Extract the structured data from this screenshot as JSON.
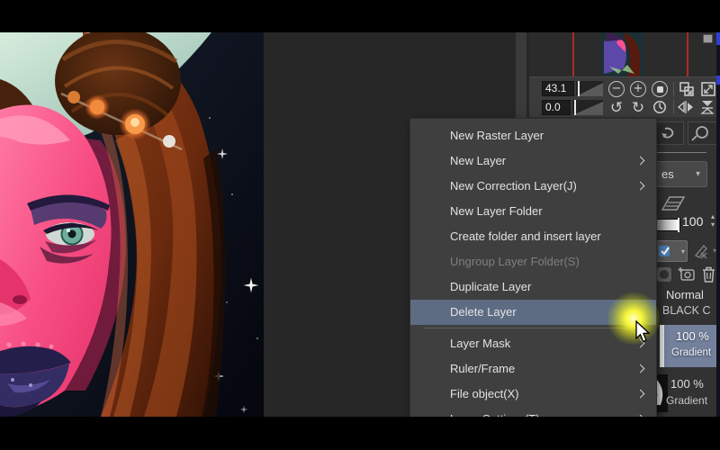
{
  "context_menu": {
    "items": [
      {
        "label": "New Raster Layer"
      },
      {
        "label": "New Layer",
        "submenu": true
      },
      {
        "label": "New Correction Layer(J)",
        "submenu": true
      },
      {
        "label": "New Layer Folder"
      },
      {
        "label": "Create folder and insert layer"
      },
      {
        "label": "Ungroup Layer Folder(S)",
        "disabled": true
      },
      {
        "label": "Duplicate Layer"
      },
      {
        "label": "Delete Layer",
        "selected": true
      },
      {
        "label": "Layer Mask",
        "submenu": true
      },
      {
        "label": "Ruler/Frame",
        "submenu": true
      },
      {
        "label": "File object(X)",
        "submenu": true
      },
      {
        "label": "Layer Settings(T)",
        "submenu": true,
        "partially_visible": true
      }
    ]
  },
  "navigator": {
    "zoom_value": "43.1",
    "rotation_value": "0.0",
    "buttons": [
      "zoom-out",
      "zoom-in",
      "actual-size",
      "fit-to-window",
      "fit-to-screen",
      "rotate-left",
      "rotate-right",
      "reset-rotation",
      "flip-horizontal",
      "fit-vertical"
    ]
  },
  "layer_property": {
    "dropdown_value": "es"
  },
  "layer_panel": {
    "blend_mode": "Normal",
    "clipped_layer_name": "BLACK C",
    "opacity_value": "100",
    "layers": [
      {
        "opacity": "100 %",
        "name": "Gradient",
        "selected": true
      },
      {
        "opacity": "100 %",
        "name": "Gradient",
        "selected": false
      }
    ]
  },
  "glyphs": {
    "minus": "−",
    "plus": "+",
    "undo": "↺",
    "redo": "↻",
    "chevron_down": "▾",
    "spin_up": "▴",
    "spin_down": "▾"
  },
  "colors": {
    "menu_bg": "#3f3f3f",
    "menu_highlight": "#5d6c83",
    "menu_text": "#e2e2e2",
    "menu_text_disabled": "#7f7f7f",
    "panel_bg": "#323232",
    "selected_layer_bg": "#73819d",
    "navigator_frame_red": "#b82c24",
    "click_glow_yellow": "#f6f73a"
  }
}
